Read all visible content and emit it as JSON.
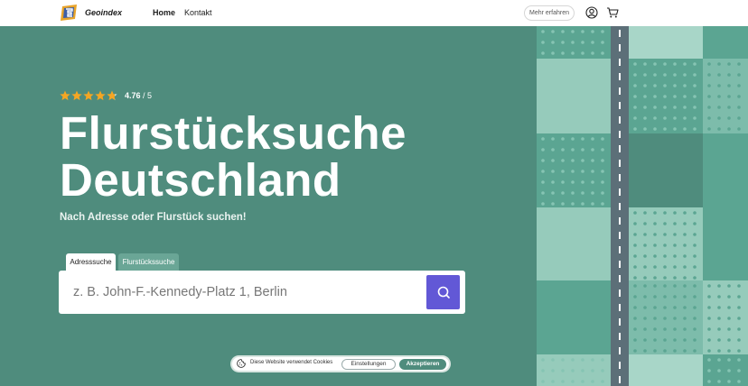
{
  "nav": {
    "brand": "Geoindex",
    "links": [
      "Home",
      "Kontakt"
    ],
    "more_button": "Mehr erfahren"
  },
  "hero": {
    "rating_value": "4.76",
    "rating_scale": "/ 5",
    "rating_stars": 4.76,
    "title_line1": "Flurstücksuche",
    "title_line2": "Deutschland",
    "subtitle": "Nach Adresse oder Flurstück suchen!"
  },
  "search": {
    "tabs": [
      "Adresssuche",
      "Flurstückssuche"
    ],
    "active_tab": "Adresssuche",
    "placeholder": "z. B. John-F.-Kennedy-Platz 1, Berlin"
  },
  "cookie": {
    "text": "Diese Website verwendet Cookies",
    "settings_label": "Einstellungen",
    "accept_label": "Akzeptieren"
  },
  "colors": {
    "hero_bg": "#4f8c7d",
    "accent": "#6258d6",
    "star": "#f5a623"
  },
  "icons": [
    "logo-icon",
    "user-icon",
    "cart-icon",
    "star-icon",
    "search-icon",
    "cookie-icon"
  ]
}
